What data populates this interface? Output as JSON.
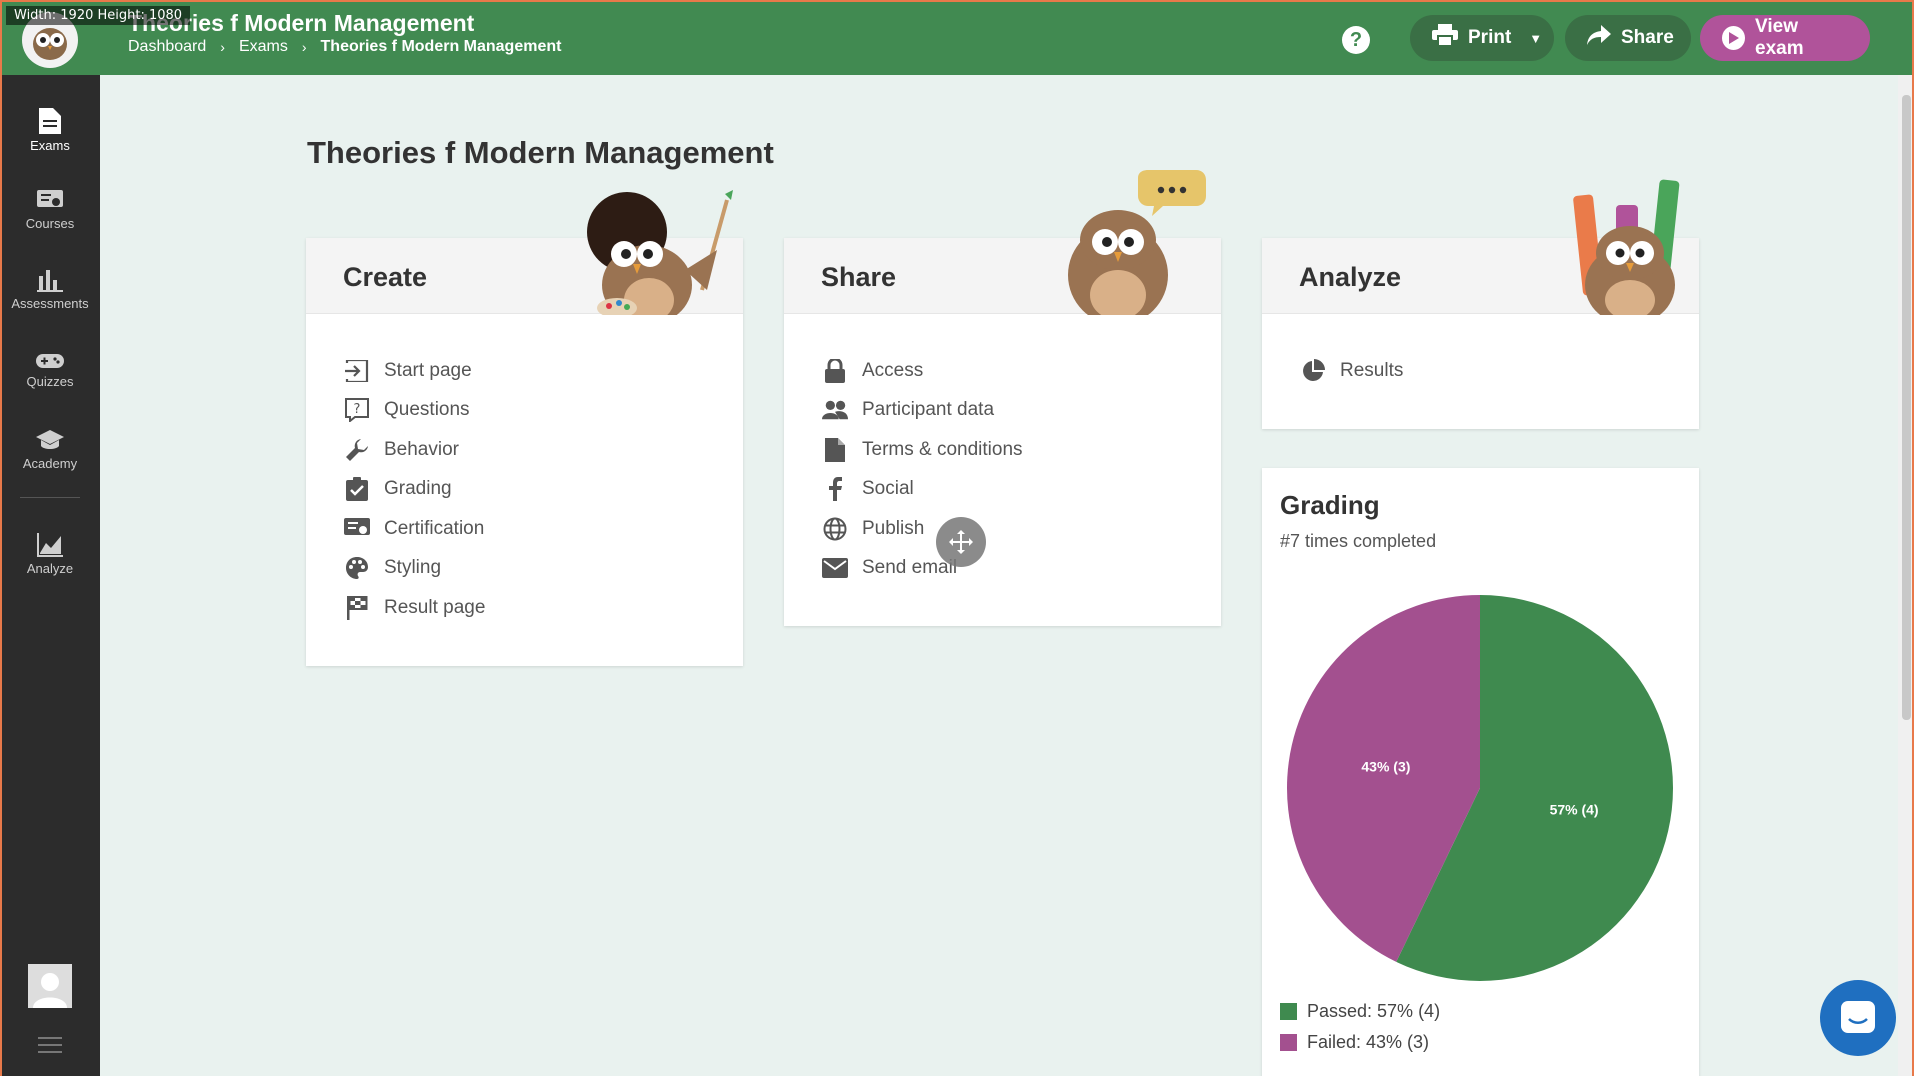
{
  "screen_overlay": {
    "dimensions": "Width: 1920  Height: 1080"
  },
  "topbar": {
    "title": "Theories f Modern Management",
    "breadcrumb": [
      "Dashboard",
      "Exams",
      "Theories f Modern Management"
    ],
    "help_label": "?",
    "print_label": "Print",
    "share_label": "Share",
    "view_label": "View exam",
    "colors": {
      "bar": "#418a51",
      "view_exam": "#b0539a"
    }
  },
  "sidebar": {
    "items": [
      {
        "label": "Exams",
        "icon": "document-icon",
        "active": true
      },
      {
        "label": "Courses",
        "icon": "certificate-icon"
      },
      {
        "label": "Assessments",
        "icon": "bar-chart-icon"
      },
      {
        "label": "Quizzes",
        "icon": "gamepad-icon"
      },
      {
        "label": "Academy",
        "icon": "graduation-cap-icon"
      },
      {
        "label": "Analyze",
        "icon": "line-chart-icon"
      }
    ]
  },
  "page": {
    "title": "Theories f Modern Management"
  },
  "create": {
    "title": "Create",
    "items": [
      {
        "label": "Start page",
        "icon": "login-icon"
      },
      {
        "label": "Questions",
        "icon": "question-box-icon"
      },
      {
        "label": "Behavior",
        "icon": "wrench-icon"
      },
      {
        "label": "Grading",
        "icon": "clipboard-check-icon"
      },
      {
        "label": "Certification",
        "icon": "certificate-icon"
      },
      {
        "label": "Styling",
        "icon": "palette-icon"
      },
      {
        "label": "Result page",
        "icon": "flag-icon"
      }
    ]
  },
  "share": {
    "title": "Share",
    "items": [
      {
        "label": "Access",
        "icon": "lock-icon"
      },
      {
        "label": "Participant data",
        "icon": "people-icon"
      },
      {
        "label": "Terms & conditions",
        "icon": "file-icon"
      },
      {
        "label": "Social",
        "icon": "facebook-icon"
      },
      {
        "label": "Publish",
        "icon": "globe-icon"
      },
      {
        "label": "Send email",
        "icon": "mail-icon"
      }
    ]
  },
  "analyze": {
    "title": "Analyze",
    "items": [
      {
        "label": "Results",
        "icon": "pie-chart-icon"
      }
    ]
  },
  "grading": {
    "title": "Grading",
    "subtitle": "#7 times completed",
    "legend": [
      {
        "label": "Passed: 57% (4)",
        "color": "#3f8a4f"
      },
      {
        "label": "Failed: 43% (3)",
        "color": "#a3508f"
      }
    ]
  },
  "chart_data": {
    "type": "pie",
    "categories": [
      "Passed",
      "Failed"
    ],
    "values": [
      4,
      3
    ],
    "data_labels": [
      "57% (4)",
      "43% (3)"
    ],
    "colors": [
      "#3f8a4f",
      "#a3508f"
    ],
    "legend": "bottom"
  }
}
